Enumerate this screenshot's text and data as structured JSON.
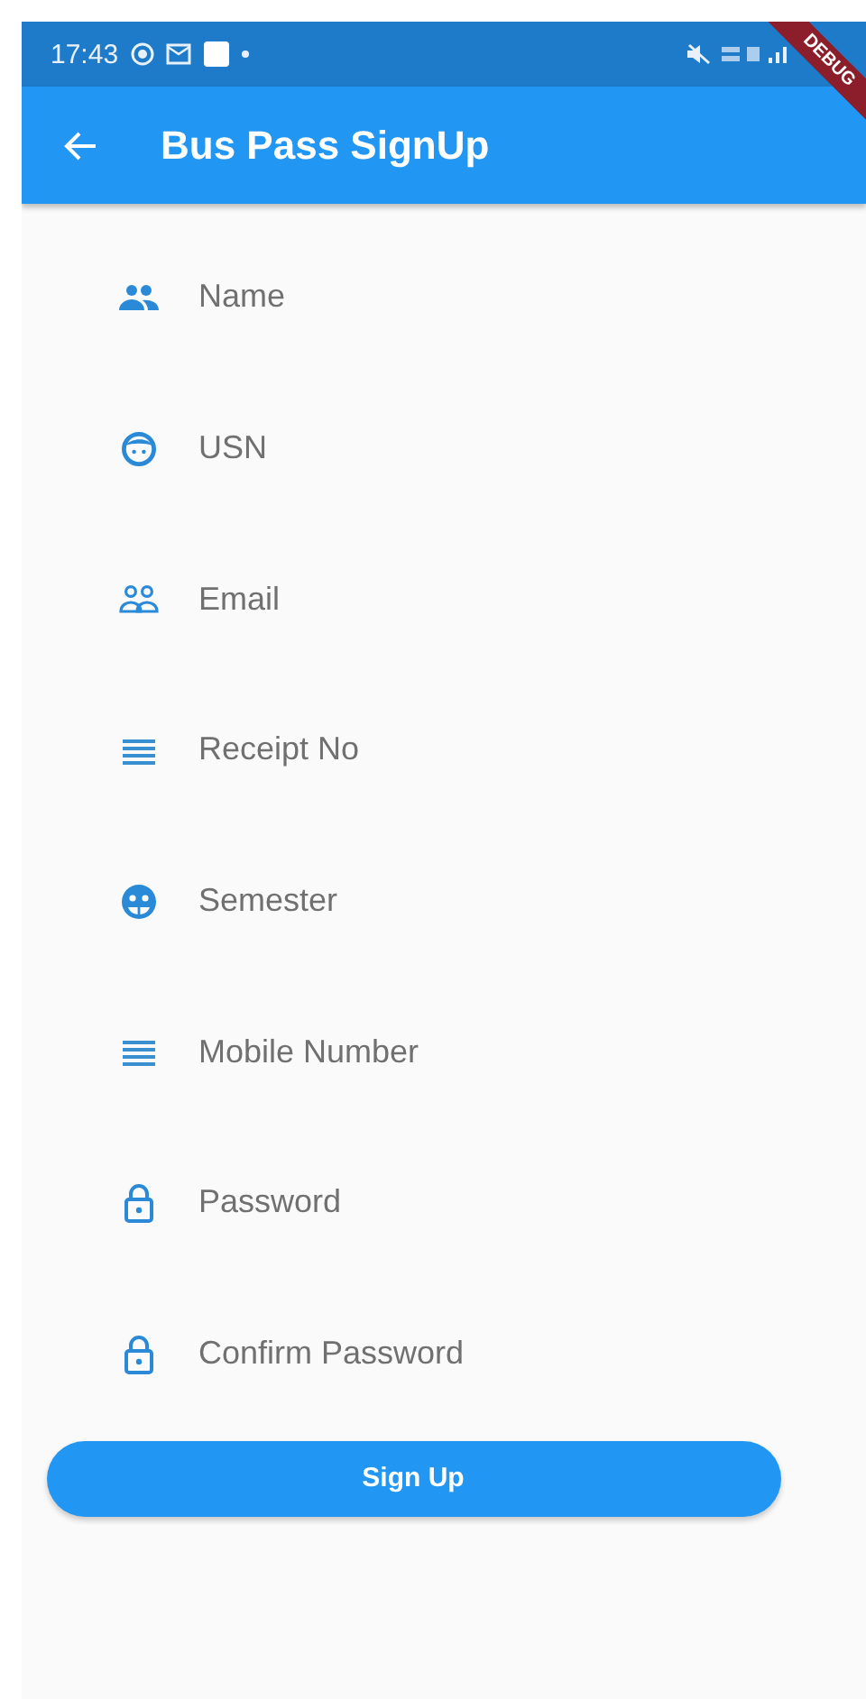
{
  "status_bar": {
    "time": "17:43"
  },
  "debug_banner": {
    "label": "DEBUG"
  },
  "app_bar": {
    "title": "Bus Pass SignUp"
  },
  "fields": [
    {
      "placeholder": "Name"
    },
    {
      "placeholder": "USN"
    },
    {
      "placeholder": "Email"
    },
    {
      "placeholder": "Receipt No"
    },
    {
      "placeholder": "Semester"
    },
    {
      "placeholder": "Mobile Number"
    },
    {
      "placeholder": "Password"
    },
    {
      "placeholder": "Confirm Password"
    }
  ],
  "buttons": [
    "Sign Up"
  ]
}
